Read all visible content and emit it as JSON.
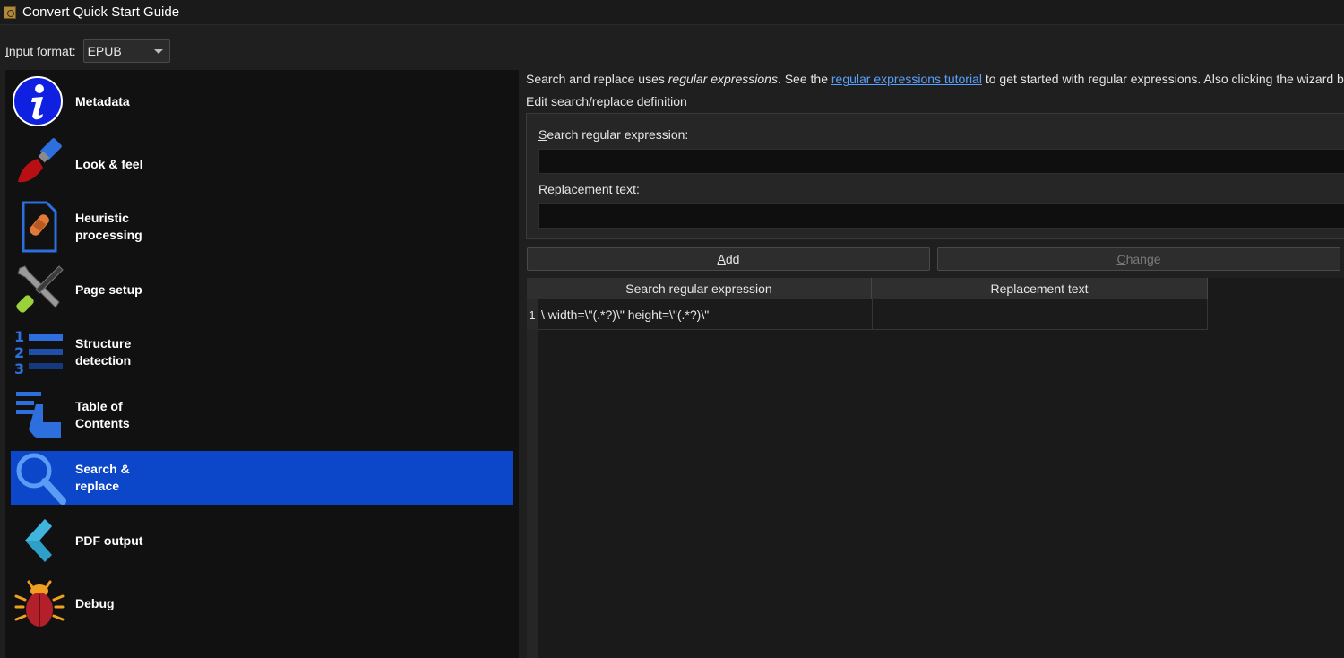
{
  "window": {
    "title": "Convert Quick Start Guide"
  },
  "input_format": {
    "label_prefix": "I",
    "label_rest": "nput format:",
    "value": "EPUB"
  },
  "sidebar": {
    "items": [
      {
        "label": "Metadata",
        "icon": "info-icon",
        "active": false
      },
      {
        "label": "Look & feel",
        "icon": "paintbrush-icon",
        "active": false
      },
      {
        "label": "Heuristic\nprocessing",
        "icon": "bandaid-document-icon",
        "active": false
      },
      {
        "label": "Page setup",
        "icon": "wrench-screwdriver-icon",
        "active": false
      },
      {
        "label": "Structure\ndetection",
        "icon": "numbered-list-icon",
        "active": false
      },
      {
        "label": "Table of\nContents",
        "icon": "toc-pointer-icon",
        "active": false
      },
      {
        "label": "Search &\nreplace",
        "icon": "magnifier-icon",
        "active": true
      },
      {
        "label": "PDF output",
        "icon": "chevron-left-icon",
        "active": false
      },
      {
        "label": "Debug",
        "icon": "bug-icon",
        "active": false
      }
    ]
  },
  "main": {
    "intro_part1": "Search and replace uses ",
    "intro_italic": "regular expressions",
    "intro_part2": ". See the ",
    "intro_link": "regular expressions tutorial",
    "intro_part3": " to get started with regular expressions. Also clicking the wizard butt",
    "group_label": "Edit search/replace definition",
    "search_label_prefix": "S",
    "search_label_rest": "earch regular expression:",
    "search_value": "",
    "replacement_label_prefix": "R",
    "replacement_label_rest": "eplacement text:",
    "replacement_value": "",
    "add_prefix": "A",
    "add_rest": "dd",
    "change_prefix": "C",
    "change_rest": "hange",
    "table": {
      "headers": [
        "Search regular expression",
        "Replacement text"
      ],
      "rows": [
        {
          "num": "1",
          "search": "\\ width=\\\"(.*?)\\\" height=\\\"(.*?)\\\"",
          "replacement": ""
        }
      ]
    }
  }
}
